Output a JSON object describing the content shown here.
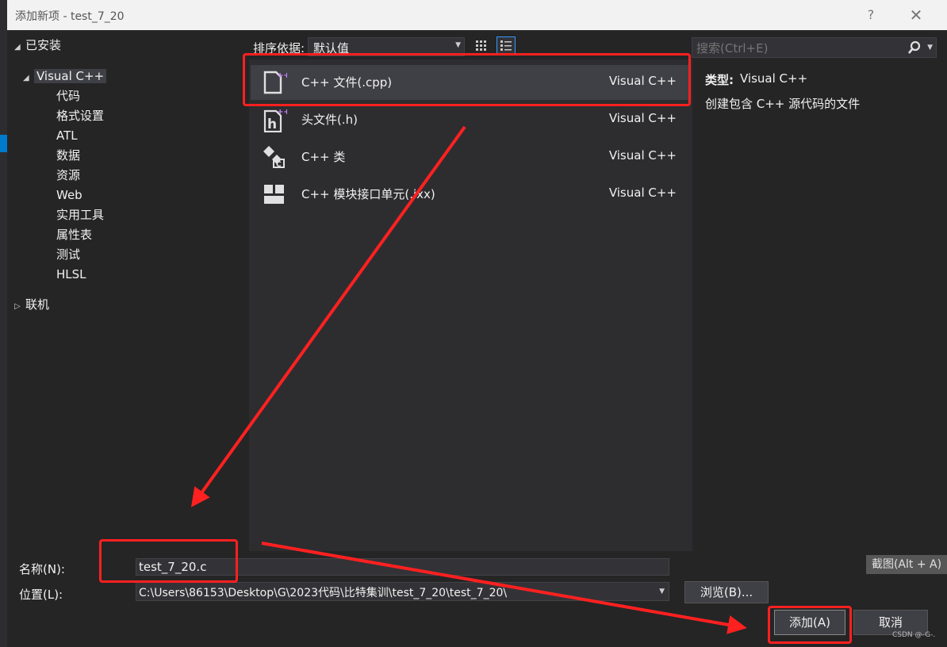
{
  "window": {
    "title": "添加新项 - test_7_20",
    "help": "?",
    "close": "✕"
  },
  "tree": {
    "installed": "已安装",
    "visual_cpp": "Visual C++",
    "children": [
      "代码",
      "格式设置",
      "ATL",
      "数据",
      "资源",
      "Web",
      "实用工具",
      "属性表",
      "测试",
      "HLSL"
    ],
    "online": "联机"
  },
  "sort": {
    "label": "排序依据:",
    "value": "默认值"
  },
  "search": {
    "placeholder": "搜索(Ctrl+E)"
  },
  "items": [
    {
      "name": "C++ 文件(.cpp)",
      "lang": "Visual C++",
      "icon": "cpp-file-icon",
      "selected": true
    },
    {
      "name": "头文件(.h)",
      "lang": "Visual C++",
      "icon": "header-file-icon",
      "selected": false
    },
    {
      "name": "C++ 类",
      "lang": "Visual C++",
      "icon": "class-icon",
      "selected": false
    },
    {
      "name": "C++ 模块接口单元(.ixx)",
      "lang": "Visual C++",
      "icon": "module-icon",
      "selected": false
    }
  ],
  "description": {
    "type_label": "类型:",
    "type_value": "Visual C++",
    "text": "创建包含 C++ 源代码的文件"
  },
  "form": {
    "name_label": "名称(N):",
    "name_value": "test_7_20.c",
    "location_label": "位置(L):",
    "location_value": "C:\\Users\\86153\\Desktop\\G\\2023代码\\比特集训\\test_7_20\\test_7_20\\"
  },
  "buttons": {
    "browse": "浏览(B)...",
    "add": "添加(A)",
    "cancel": "取消"
  },
  "tooltip": "截图(Alt + A)",
  "watermark": "CSDN @-G-.",
  "colors": {
    "accent": "#007acc",
    "annotation_red": "#ff2020",
    "panel": "#2d2d30",
    "selected": "#3f3f46"
  }
}
